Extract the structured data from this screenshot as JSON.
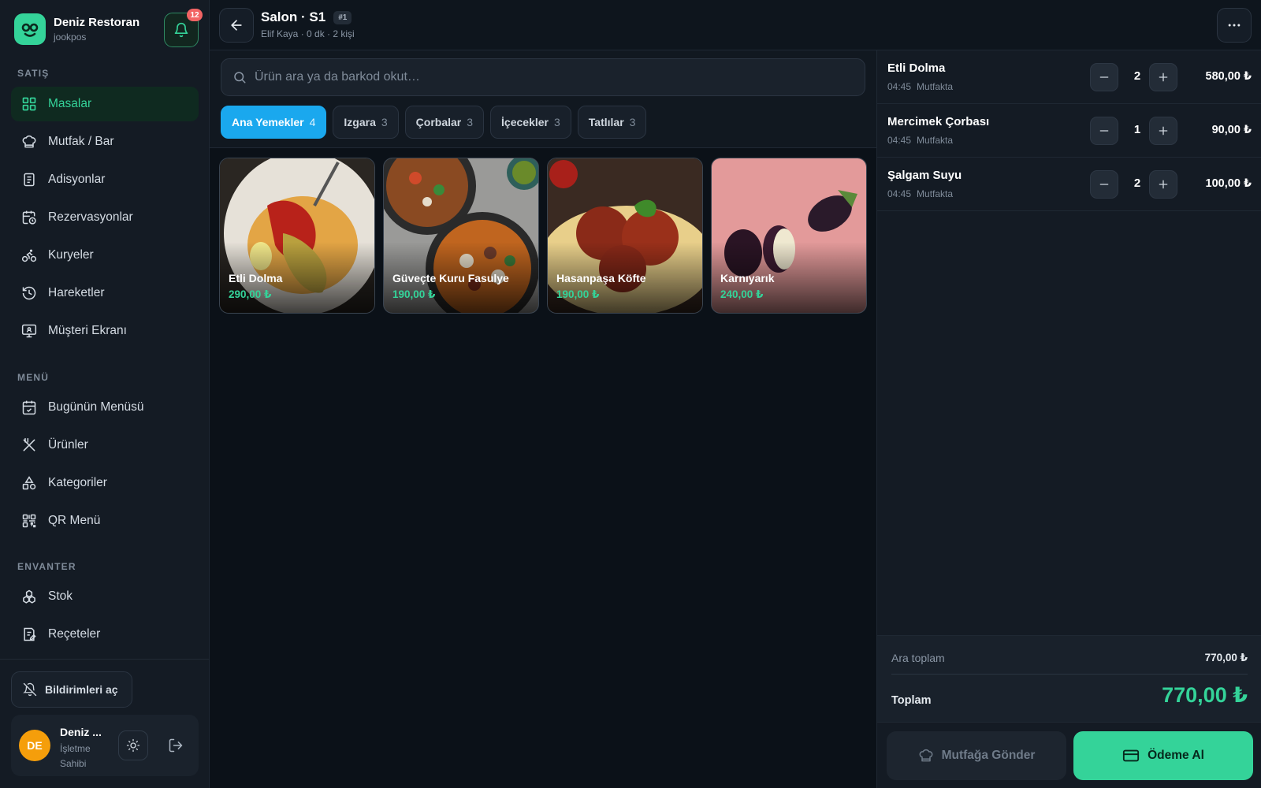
{
  "brand": {
    "name": "Deniz Restoran",
    "sub": "jookpos",
    "notification_count": "12"
  },
  "sidebar": {
    "sections": [
      "SATIŞ",
      "MENÜ",
      "ENVANTER"
    ],
    "items": [
      {
        "label": "Masalar",
        "icon": "grid-icon"
      },
      {
        "label": "Mutfak / Bar",
        "icon": "chef-hat-icon"
      },
      {
        "label": "Adisyonlar",
        "icon": "receipt-icon"
      },
      {
        "label": "Rezervasyonlar",
        "icon": "calendar-clock-icon"
      },
      {
        "label": "Kuryeler",
        "icon": "bike-icon"
      },
      {
        "label": "Hareketler",
        "icon": "history-icon"
      },
      {
        "label": "Müşteri Ekranı",
        "icon": "monitor-icon"
      },
      {
        "label": "Bugünün Menüsü",
        "icon": "calendar-check-icon"
      },
      {
        "label": "Ürünler",
        "icon": "utensils-icon"
      },
      {
        "label": "Kategoriler",
        "icon": "shapes-icon"
      },
      {
        "label": "QR Menü",
        "icon": "qr-code-icon"
      },
      {
        "label": "Stok",
        "icon": "boxes-icon"
      },
      {
        "label": "Reçeteler",
        "icon": "recipe-icon"
      }
    ],
    "notif_button": "Bildirimleri aç",
    "user": {
      "initials": "DE",
      "name": "Deniz ...",
      "role": "İşletme Sahibi"
    }
  },
  "header": {
    "title": "Salon · S1",
    "order_tag": "#1",
    "subtitle": "Elif Kaya · 0 dk · 2 kişi"
  },
  "search": {
    "placeholder": "Ürün ara ya da barkod okut…"
  },
  "categories": [
    {
      "label": "Ana Yemekler",
      "count": "4"
    },
    {
      "label": "Izgara",
      "count": "3"
    },
    {
      "label": "Çorbalar",
      "count": "3"
    },
    {
      "label": "İçecekler",
      "count": "3"
    },
    {
      "label": "Tatlılar",
      "count": "3"
    }
  ],
  "products": [
    {
      "name": "Etli Dolma",
      "price": "290,00 ₺"
    },
    {
      "name": "Güveçte Kuru Fasulye",
      "price": "190,00 ₺"
    },
    {
      "name": "Hasanpaşa Köfte",
      "price": "190,00 ₺"
    },
    {
      "name": "Karnıyarık",
      "price": "240,00 ₺"
    }
  ],
  "order": {
    "lines": [
      {
        "name": "Etli Dolma",
        "time": "04:45",
        "status": "Mutfakta",
        "qty": "2",
        "price": "580,00 ₺"
      },
      {
        "name": "Mercimek Çorbası",
        "time": "04:45",
        "status": "Mutfakta",
        "qty": "1",
        "price": "90,00 ₺"
      },
      {
        "name": "Şalgam Suyu",
        "time": "04:45",
        "status": "Mutfakta",
        "qty": "2",
        "price": "100,00 ₺"
      }
    ],
    "subtotal_label": "Ara toplam",
    "subtotal": "770,00 ₺",
    "total_label": "Toplam",
    "total": "770,00 ₺",
    "send_kitchen": "Mutfağa Gönder",
    "pay": "Ödeme Al"
  },
  "colors": {
    "accent": "#34d399",
    "active_chip": "#1aa8ee",
    "badge": "#f26464",
    "avatar": "#f59e0b"
  }
}
